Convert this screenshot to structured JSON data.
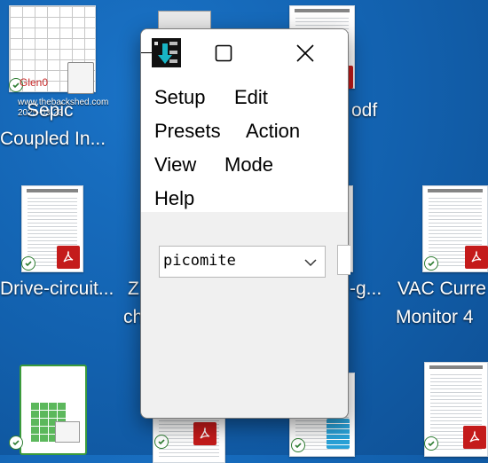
{
  "desktop": {
    "icons": [
      {
        "id": "top-left",
        "label_lines": [
          "Sepic",
          "Coupled In..."
        ],
        "overlay_texts": [
          "Glen0",
          "www.thebackshed.com",
          "2025-03-23"
        ]
      },
      {
        "id": "top-right-pdf",
        "label_lines": [
          "odf"
        ]
      },
      {
        "id": "mid-left-pdf",
        "label_lines": [
          "Drive-circuit..."
        ]
      },
      {
        "id": "mid-center",
        "label_lines": [
          "Z",
          "ch"
        ]
      },
      {
        "id": "mid-right-partial",
        "label_lines": [
          "-g..."
        ]
      },
      {
        "id": "mid-far-right-pdf",
        "label_lines": [
          "VAC Curre",
          "Monitor 4"
        ]
      }
    ]
  },
  "window": {
    "title_icon": "console-app-icon",
    "controls": {
      "maximize": "maximize-icon",
      "close": "close-icon"
    },
    "menu": [
      "Setup",
      "Edit",
      "Presets",
      "Action",
      "View",
      "Mode",
      "Help"
    ],
    "combo": {
      "value": "picomite"
    }
  },
  "colors": {
    "desktop": "#1565b5",
    "window_bg": "#f0f0f0",
    "pdf_red": "#c41b1b",
    "sync_green": "#2e7d32"
  }
}
